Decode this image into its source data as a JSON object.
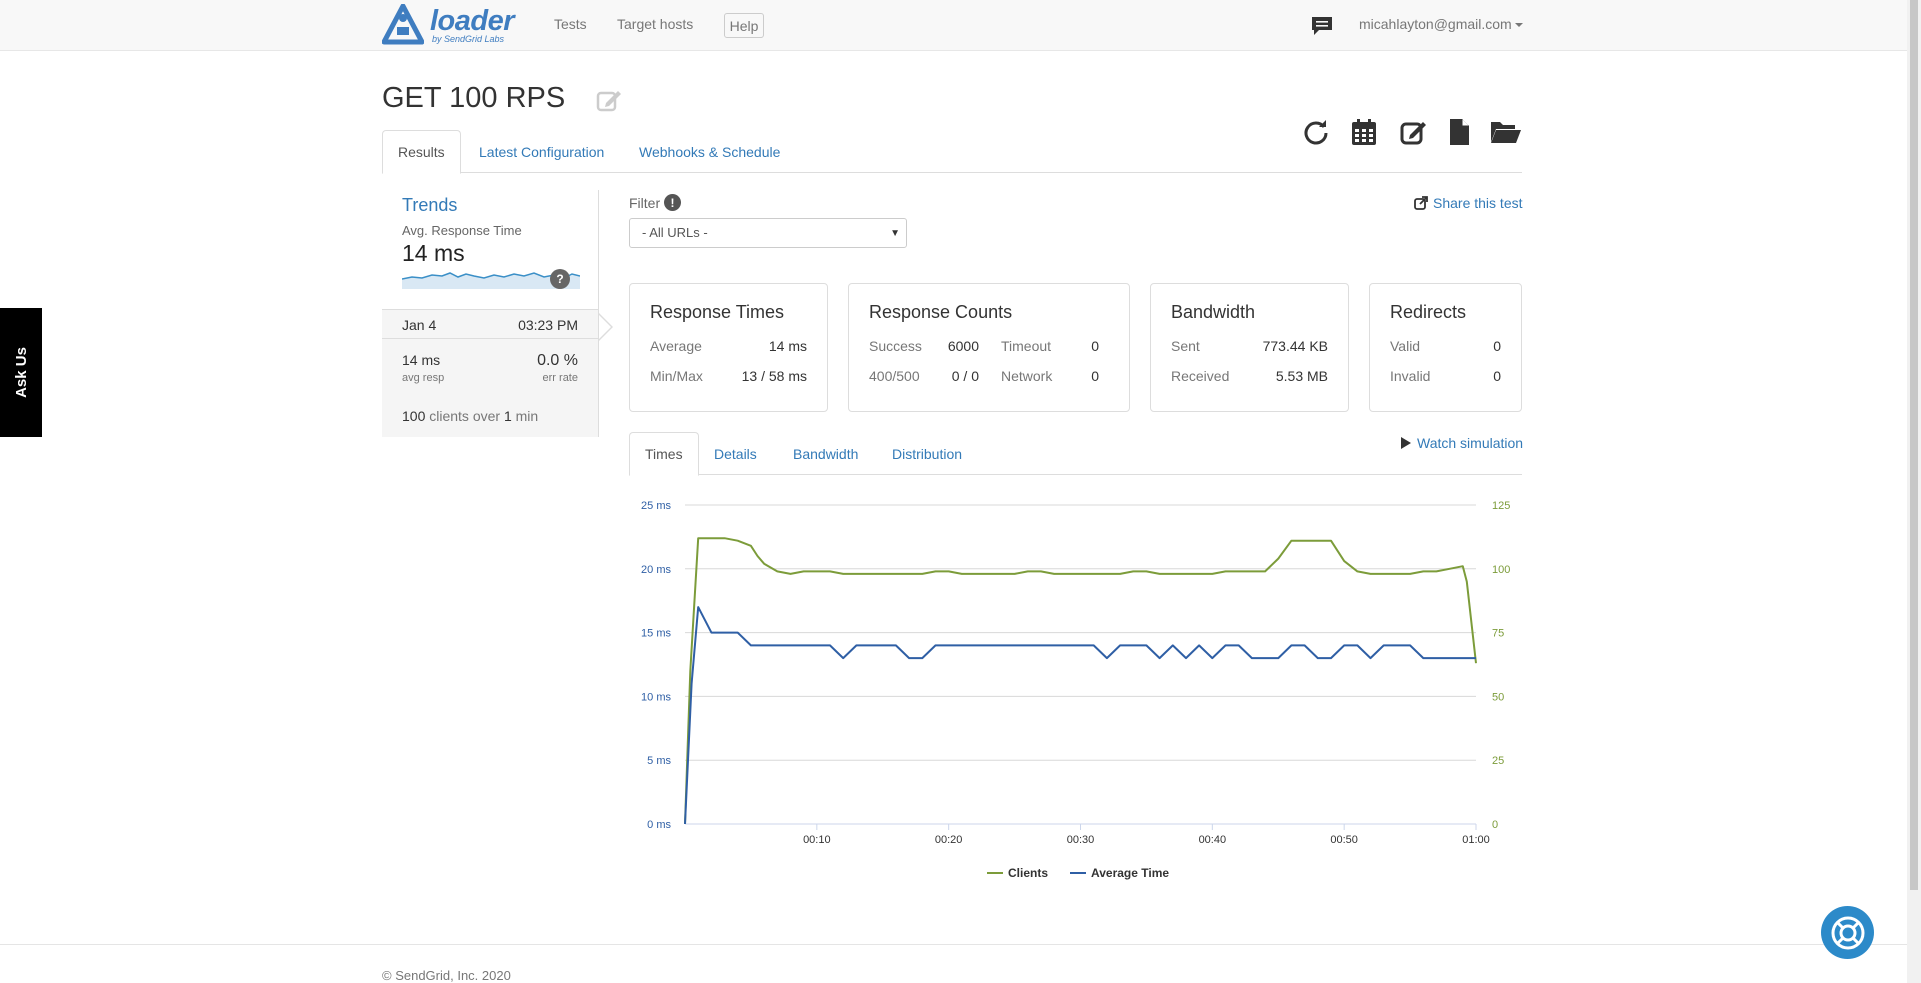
{
  "navbar": {
    "logo_word": "loader",
    "logo_sub": "by SendGrid Labs",
    "links": [
      "Tests",
      "Target hosts"
    ],
    "help_label": "Help",
    "user_email": "micahlayton@gmail.com"
  },
  "page": {
    "title": "GET 100 RPS",
    "tabs": [
      "Results",
      "Latest Configuration",
      "Webhooks & Schedule"
    ],
    "active_tab": "Results"
  },
  "toolbar": {
    "icons": [
      "refresh-icon",
      "calendar-icon",
      "edit-icon",
      "document-icon",
      "folder-open-icon"
    ]
  },
  "trends": {
    "title": "Trends",
    "label": "Avg. Response Time",
    "value": "14 ms",
    "help": "?"
  },
  "run": {
    "date": "Jan 4",
    "time": "03:23 PM",
    "avg_resp": "14 ms",
    "avg_resp_label": "avg resp",
    "err_rate": "0.0 %",
    "err_rate_label": "err rate",
    "clients_count": "100",
    "clients_mid": "clients over",
    "duration": "1",
    "duration_unit": "min"
  },
  "filter": {
    "label": "Filter",
    "info": "!",
    "selected": "- All URLs -"
  },
  "share_label": "Share this test",
  "cards": {
    "response_times": {
      "title": "Response Times",
      "average_label": "Average",
      "average": "14 ms",
      "minmax_label": "Min/Max",
      "minmax": "13 / 58 ms"
    },
    "response_counts": {
      "title": "Response Counts",
      "success_label": "Success",
      "success": "6000",
      "timeout_label": "Timeout",
      "timeout": "0",
      "err_label": "400/500",
      "err": "0 / 0",
      "network_label": "Network",
      "network": "0"
    },
    "bandwidth": {
      "title": "Bandwidth",
      "sent_label": "Sent",
      "sent": "773.44 KB",
      "received_label": "Received",
      "received": "5.53 MB"
    },
    "redirects": {
      "title": "Redirects",
      "valid_label": "Valid",
      "valid": "0",
      "invalid_label": "Invalid",
      "invalid": "0"
    }
  },
  "subtabs": [
    "Times",
    "Details",
    "Bandwidth",
    "Distribution"
  ],
  "active_subtab": "Times",
  "watch_label": "Watch simulation",
  "colors": {
    "clients": "#7c9c3a",
    "avg_time": "#2f5fa5",
    "link": "#337ab7"
  },
  "chart_data": {
    "type": "line",
    "x_ticks": [
      "00:10",
      "00:20",
      "00:30",
      "00:40",
      "00:50",
      "01:00"
    ],
    "y_left_ticks": [
      "0 ms",
      "5 ms",
      "10 ms",
      "15 ms",
      "20 ms",
      "25 ms"
    ],
    "y_right_ticks": [
      "0",
      "25",
      "50",
      "75",
      "100",
      "125"
    ],
    "ylim_left": [
      0,
      25
    ],
    "ylim_right": [
      0,
      125
    ],
    "xlim": [
      0,
      60
    ],
    "grid": true,
    "legend_position": "bottom-center",
    "series": [
      {
        "name": "Clients",
        "axis": "right",
        "x": [
          0,
          0.4,
          1,
          2,
          3,
          4,
          5,
          5.5,
          6,
          7,
          8,
          9,
          10,
          11,
          12,
          13,
          14,
          15,
          16,
          17,
          18,
          19,
          20,
          21,
          22,
          23,
          24,
          25,
          26,
          27,
          28,
          29,
          30,
          31,
          32,
          33,
          34,
          35,
          36,
          37,
          38,
          39,
          40,
          41,
          42,
          43,
          44,
          45,
          46,
          47,
          48,
          49,
          50,
          51,
          52,
          53,
          54,
          55,
          56,
          57,
          58,
          59,
          59.3,
          60
        ],
        "values": [
          0,
          60,
          112,
          112,
          112,
          111,
          109,
          105,
          102,
          99,
          98,
          99,
          99,
          99,
          98,
          98,
          98,
          98,
          98,
          98,
          98,
          99,
          99,
          98,
          98,
          98,
          98,
          98,
          99,
          99,
          98,
          98,
          98,
          98,
          98,
          98,
          99,
          99,
          98,
          98,
          98,
          98,
          98,
          99,
          99,
          99,
          99,
          104,
          111,
          111,
          111,
          111,
          103,
          99,
          98,
          98,
          98,
          98,
          99,
          99,
          100,
          101,
          95,
          63
        ]
      },
      {
        "name": "Average Time",
        "axis": "left",
        "x": [
          0,
          0.5,
          1,
          1.5,
          2,
          3,
          4,
          5,
          6,
          7,
          8,
          10,
          11,
          12,
          13,
          16,
          17,
          18,
          19,
          25,
          30,
          31,
          32,
          33,
          35,
          36,
          37,
          38,
          39,
          40,
          41,
          42,
          43,
          44,
          45,
          46,
          47,
          48,
          49,
          50,
          51,
          52,
          53,
          54,
          55,
          56,
          57,
          58,
          59,
          60
        ],
        "values": [
          0,
          11,
          17,
          16,
          15,
          15,
          15,
          14,
          14,
          14,
          14,
          14,
          14,
          13,
          14,
          14,
          13,
          13,
          14,
          14,
          14,
          14,
          13,
          14,
          14,
          13,
          14,
          13,
          14,
          13,
          14,
          14,
          13,
          13,
          13,
          14,
          14,
          13,
          13,
          14,
          14,
          13,
          14,
          14,
          14,
          13,
          13,
          13,
          13,
          13
        ]
      }
    ]
  },
  "footer": {
    "copyright": "© SendGrid, Inc. 2020"
  },
  "ask_us": "Ask Us"
}
